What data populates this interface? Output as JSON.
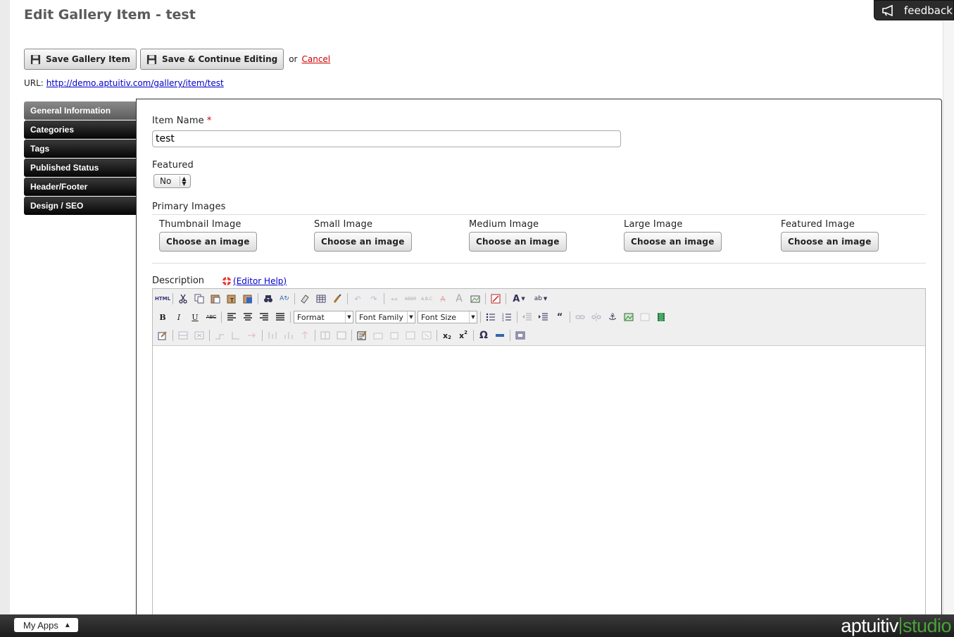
{
  "page": {
    "title": "Edit Gallery Item - test"
  },
  "feedback": {
    "label": "feedback",
    "icon": "megaphone-icon"
  },
  "toolbar": {
    "save_label": "Save Gallery Item",
    "save_continue_label": "Save & Continue Editing",
    "or_text": "or",
    "cancel_label": "Cancel"
  },
  "url": {
    "prefix": "URL:",
    "link": "http://demo.aptuitiv.com/gallery/item/test"
  },
  "sidebar": {
    "items": [
      {
        "label": "General Information",
        "active": true
      },
      {
        "label": "Categories",
        "active": false
      },
      {
        "label": "Tags",
        "active": false
      },
      {
        "label": "Published Status",
        "active": false
      },
      {
        "label": "Header/Footer",
        "active": false
      },
      {
        "label": "Design / SEO",
        "active": false
      }
    ]
  },
  "form": {
    "item_name_label": "Item Name",
    "required_mark": "*",
    "item_name_value": "test",
    "featured_label": "Featured",
    "featured_value": "No",
    "primary_images_label": "Primary Images",
    "images": [
      {
        "title": "Thumbnail Image",
        "button": "Choose an image"
      },
      {
        "title": "Small Image",
        "button": "Choose an image"
      },
      {
        "title": "Medium Image",
        "button": "Choose an image"
      },
      {
        "title": "Large Image",
        "button": "Choose an image"
      },
      {
        "title": "Featured Image",
        "button": "Choose an image"
      }
    ],
    "description_label": "Description",
    "editor_help_label": "(Editor Help)"
  },
  "editor": {
    "format_label": "Format",
    "font_family_label": "Font Family",
    "font_size_label": "Font Size"
  },
  "bottom_bar": {
    "my_apps_label": "My Apps",
    "brand_left": "aptuitiv",
    "brand_right": "studio",
    "brand_color": "#4aa23a"
  }
}
